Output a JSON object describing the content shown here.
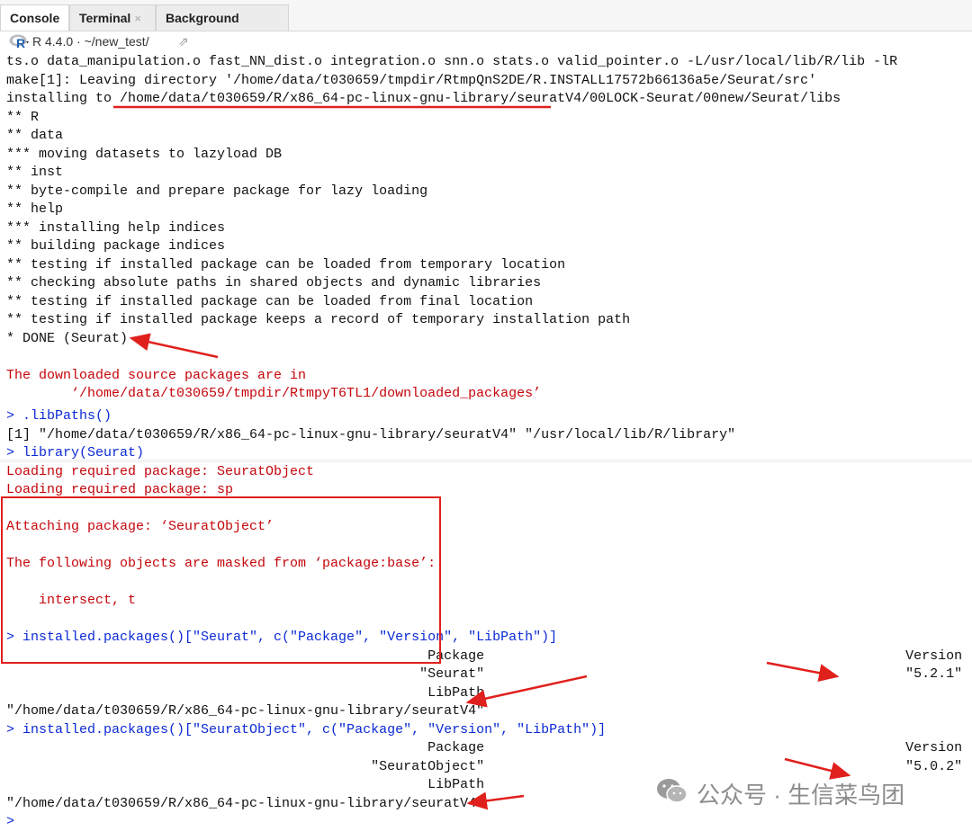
{
  "tabs": [
    {
      "label": "Console",
      "active": true
    },
    {
      "label": "Terminal",
      "close": "×"
    },
    {
      "label": "Background Jobs",
      "close": "×"
    }
  ],
  "pathbar": {
    "r_version": "R 4.4.0",
    "sep": "·",
    "path": "~/new_test/",
    "logo_letter": "R"
  },
  "console_top": [
    {
      "text": "ts.o data_manipulation.o fast_NN_dist.o integration.o snn.o stats.o valid_pointer.o -L/usr/local/lib/R/lib -lR",
      "color": "black"
    },
    {
      "text": "make[1]: Leaving directory '/home/data/t030659/tmpdir/RtmpQnS2DE/R.INSTALL17572b66136a5e/Seurat/src'",
      "color": "black"
    },
    {
      "text": "installing to /home/data/t030659/R/x86_64-pc-linux-gnu-library/seuratV4/00LOCK-Seurat/00new/Seurat/libs",
      "color": "black"
    },
    {
      "text": "** R",
      "color": "black"
    },
    {
      "text": "** data",
      "color": "black"
    },
    {
      "text": "*** moving datasets to lazyload DB",
      "color": "black"
    },
    {
      "text": "** inst",
      "color": "black"
    },
    {
      "text": "** byte-compile and prepare package for lazy loading",
      "color": "black"
    },
    {
      "text": "** help",
      "color": "black"
    },
    {
      "text": "*** installing help indices",
      "color": "black"
    },
    {
      "text": "** building package indices",
      "color": "black"
    },
    {
      "text": "** testing if installed package can be loaded from temporary location",
      "color": "black"
    },
    {
      "text": "** checking absolute paths in shared objects and dynamic libraries",
      "color": "black"
    },
    {
      "text": "** testing if installed package can be loaded from final location",
      "color": "black"
    },
    {
      "text": "** testing if installed package keeps a record of temporary installation path",
      "color": "black"
    },
    {
      "text": "* DONE (Seurat)",
      "color": "black"
    },
    {
      "text": "",
      "color": "black"
    },
    {
      "text": "The downloaded source packages are in",
      "color": "red"
    },
    {
      "text": "        ‘/home/data/t030659/tmpdir/RtmpyT6TL1/downloaded_packages’",
      "color": "red"
    }
  ],
  "console_bottom": [
    {
      "text": "> .libPaths()",
      "color": "blue"
    },
    {
      "text": "[1] \"/home/data/t030659/R/x86_64-pc-linux-gnu-library/seuratV4\" \"/usr/local/lib/R/library\"",
      "color": "black"
    },
    {
      "text": "> library(Seurat)",
      "color": "blue"
    },
    {
      "text": "Loading required package: SeuratObject",
      "color": "red"
    },
    {
      "text": "Loading required package: sp",
      "color": "red"
    },
    {
      "text": "",
      "color": "red"
    },
    {
      "text": "Attaching package: ‘SeuratObject’",
      "color": "red"
    },
    {
      "text": "",
      "color": "red"
    },
    {
      "text": "The following objects are masked from ‘package:base’:",
      "color": "red"
    },
    {
      "text": "",
      "color": "red"
    },
    {
      "text": "    intersect, t",
      "color": "red"
    },
    {
      "text": "",
      "color": "black"
    },
    {
      "text": "> installed.packages()[\"Seurat\", c(\"Package\", \"Version\", \"LibPath\")]",
      "color": "blue"
    },
    {
      "text": "                                                    Package                                                    Version",
      "color": "black"
    },
    {
      "text": "                                                   \"Seurat\"                                                    \"5.2.1\"",
      "color": "black"
    },
    {
      "text": "                                                    LibPath",
      "color": "black"
    },
    {
      "text": "\"/home/data/t030659/R/x86_64-pc-linux-gnu-library/seuratV4\"",
      "color": "black"
    },
    {
      "text": "> installed.packages()[\"SeuratObject\", c(\"Package\", \"Version\", \"LibPath\")]",
      "color": "blue"
    },
    {
      "text": "                                                    Package                                                    Version",
      "color": "black"
    },
    {
      "text": "                                             \"SeuratObject\"                                                    \"5.0.2\"",
      "color": "black"
    },
    {
      "text": "                                                    LibPath",
      "color": "black"
    },
    {
      "text": "\"/home/data/t030659/R/x86_64-pc-linux-gnu-library/seuratV4\"",
      "color": "black"
    },
    {
      "text": ">",
      "color": "blue"
    }
  ],
  "watermark": "公众号 · 生信菜鸟团",
  "colors": {
    "red": "#c5060b",
    "blue": "#0b2ad6",
    "annotation": "#e0201c"
  }
}
